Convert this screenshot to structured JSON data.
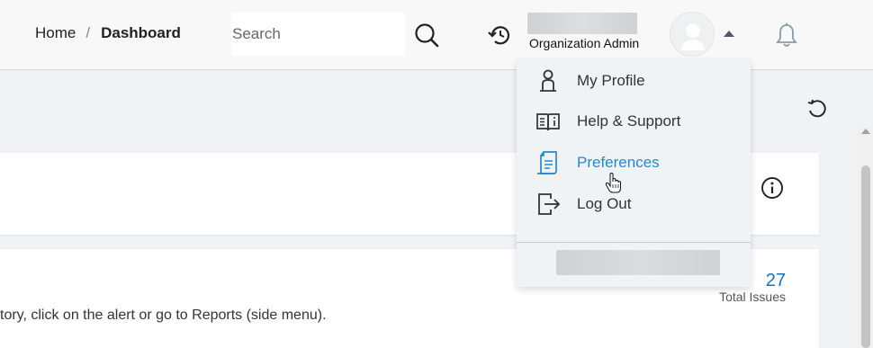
{
  "breadcrumb": {
    "home": "Home",
    "separator": "/",
    "current": "Dashboard"
  },
  "search": {
    "placeholder": "Search"
  },
  "icons": {
    "search": "search-icon",
    "history": "history-icon",
    "bell": "bell-icon",
    "refresh": "refresh-icon",
    "info": "info-icon"
  },
  "profile": {
    "role": "Organization Admin"
  },
  "menu": {
    "items": [
      {
        "label": "My Profile",
        "icon": "person-icon"
      },
      {
        "label": "Help & Support",
        "icon": "book-icon"
      },
      {
        "label": "Preferences",
        "icon": "document-icon",
        "active": true
      },
      {
        "label": "Log Out",
        "icon": "logout-icon"
      }
    ]
  },
  "main": {
    "alert_text": "tory, click on the alert or go to Reports (side menu).",
    "issues_count": "27",
    "issues_label": "Total Issues"
  },
  "colors": {
    "accent": "#2389d6",
    "count": "#1a6fb8",
    "dropdown_bg": "#eff3f5"
  }
}
